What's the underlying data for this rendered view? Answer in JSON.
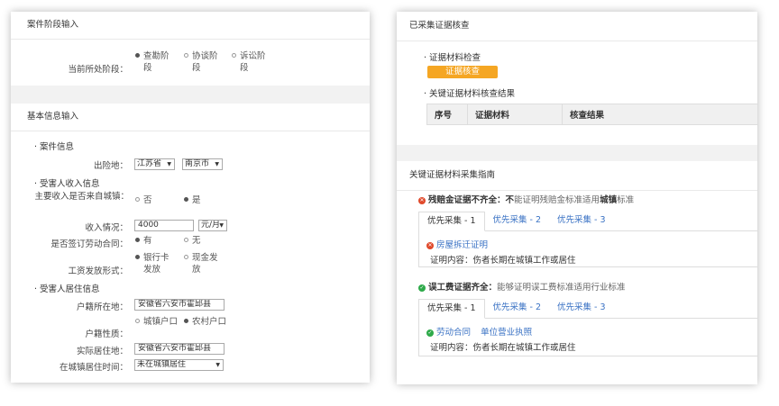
{
  "left": {
    "stage": {
      "title": "案件阶段输入",
      "label": "当前所处阶段：",
      "options": [
        "查勘阶段",
        "协谈阶段",
        "诉讼阶段"
      ],
      "selected": 0
    },
    "basic": {
      "title": "基本信息输入",
      "case_info": "· 案件信息",
      "accident_label": "出险地：",
      "province": "江苏省",
      "city": "南京市",
      "income_title": "· 受害人收入信息",
      "urban_income_label": "主要收入是否来自城镇：",
      "no": "否",
      "yes": "是",
      "income_label": "收入情况：",
      "income_value": "4000",
      "income_unit": "元/月",
      "contract_label": "是否签订劳动合同：",
      "has": "有",
      "none": "无",
      "wage_label": "工资发放形式：",
      "wage_options": [
        "银行卡发放",
        "现金发放"
      ],
      "residence_title": "· 受害人居住信息",
      "hukou_label": "户籍所在地：",
      "hukou_value": "安徽省六安市霍邱县",
      "hukou_type_label": "户籍性质：",
      "hukou_types": [
        "城镇户口",
        "农村户口"
      ],
      "actual_label": "实际居住地：",
      "actual_value": "安徽省六安市霍邱县",
      "urban_time_label": "在城镇居住时间：",
      "urban_time_value": "未在城镇居住"
    }
  },
  "right": {
    "collected": {
      "title": "已采集证据核查",
      "check_label": "· 证据材料检查",
      "check_button": "证据核查",
      "result_label": "· 关键证据材料核查结果",
      "columns": [
        "序号",
        "证据材料",
        "核查结果"
      ]
    },
    "guide": {
      "title": "关键证据材料采集指南",
      "block1": {
        "head_bold": "残赔金证据不齐全：不",
        "head_normal": "能证明残赔金标准适用",
        "head_bold2": "城镇",
        "head_tail": "标准",
        "tabs": [
          "优先采集 - 1",
          "优先采集 - 2",
          "优先采集 - 3"
        ],
        "item": "房屋拆迁证明",
        "content": "证明内容：伤者长期在城镇工作或居住"
      },
      "block2": {
        "head_bold": "误工费证据齐全：",
        "head_normal": "能够证明误工费标准适用行业标准",
        "tabs": [
          "优先采集 - 1",
          "优先采集 - 2",
          "优先采集 - 3"
        ],
        "items": [
          "劳动合同",
          "单位营业执照"
        ],
        "content": "证明内容：伤者长期在城镇工作或居住"
      }
    }
  }
}
